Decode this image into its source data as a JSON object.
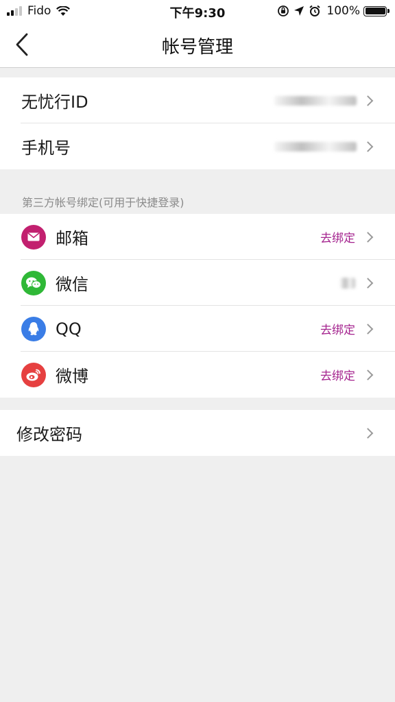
{
  "status_bar": {
    "carrier": "Fido",
    "time": "下午9:30",
    "battery": "100%"
  },
  "nav": {
    "title": "帐号管理"
  },
  "account": {
    "id_label": "无忧行ID",
    "phone_label": "手机号"
  },
  "third_party": {
    "header": "第三方帐号绑定(可用于快捷登录)",
    "items": [
      {
        "label": "邮箱",
        "action": "去绑定",
        "icon": "mail-icon",
        "color": "#c2206f"
      },
      {
        "label": "微信",
        "action": "",
        "icon": "wechat-icon",
        "color": "#2fb837"
      },
      {
        "label": "QQ",
        "action": "去绑定",
        "icon": "qq-icon",
        "color": "#3a7de6"
      },
      {
        "label": "微博",
        "action": "去绑定",
        "icon": "weibo-icon",
        "color": "#e64040"
      }
    ]
  },
  "password": {
    "label": "修改密码"
  },
  "colors": {
    "accent": "#a4238e",
    "background": "#efefef"
  }
}
